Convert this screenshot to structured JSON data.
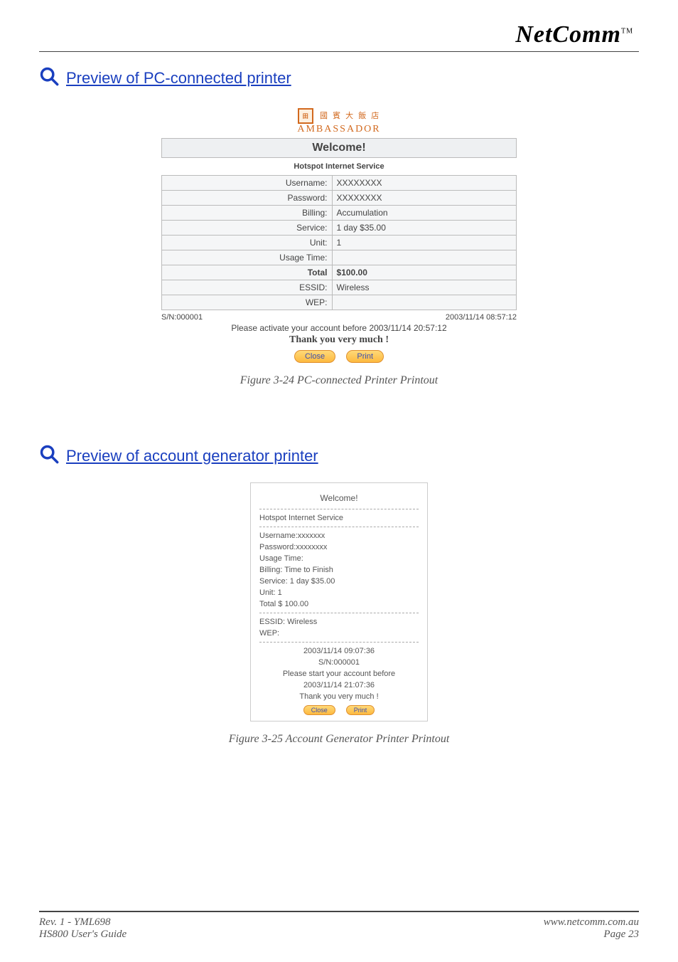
{
  "brand": {
    "name": "NetComm",
    "tm": "TM"
  },
  "section1": {
    "link": "Preview of PC-connected printer",
    "logo_top": "國 賓 大 飯 店",
    "logo_bottom": "AMBASSADOR",
    "welcome": "Welcome!",
    "service_name": "Hotspot Internet Service",
    "rows": {
      "username_label": "Username:",
      "username_value": "XXXXXXXX",
      "password_label": "Password:",
      "password_value": "XXXXXXXX",
      "billing_label": "Billing:",
      "billing_value": "Accumulation",
      "service_label": "Service:",
      "service_value": "1 day $35.00",
      "unit_label": "Unit:",
      "unit_value": "1",
      "usage_label": "Usage Time:",
      "usage_value": "",
      "total_label": "Total",
      "total_value": "$100.00",
      "essid_label": "ESSID:",
      "essid_value": "Wireless",
      "wep_label": "WEP:",
      "wep_value": ""
    },
    "sn": "S/N:000001",
    "timestamp": "2003/11/14 08:57:12",
    "activate": "Please activate your account before  2003/11/14 20:57:12",
    "thank": "Thank you very much !",
    "btn_close": "Close",
    "btn_print": "Print",
    "caption": "Figure 3-24 PC-connected Printer Printout"
  },
  "section2": {
    "link": "Preview of account generator printer",
    "title": "Welcome!",
    "service_name": "Hotspot Internet Service",
    "lines": {
      "username": "Username:xxxxxxx",
      "password": "Password:xxxxxxxx",
      "usage": "Usage Time:",
      "billing": "Billing: Time to Finish",
      "service": "Service: 1 day $35.00",
      "unit": "Unit: 1",
      "total": "Total $ 100.00",
      "essid": "ESSID: Wireless",
      "wep": "WEP:"
    },
    "timestamp": "2003/11/14 09:07:36",
    "sn": "S/N:000001",
    "activate1": "Please start your account before",
    "activate2": "2003/11/14 21:07:36",
    "thank": "Thank you very much !",
    "btn_close": "Close",
    "btn_print": "Print",
    "caption": "Figure 3-25 Account Generator Printer Printout"
  },
  "footer": {
    "rev": "Rev. 1 - YML698",
    "url": "www.netcomm.com.au",
    "guide": "HS800 User's Guide",
    "page": "Page 23"
  }
}
